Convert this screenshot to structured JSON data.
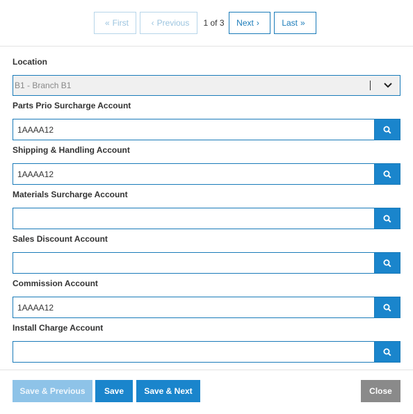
{
  "pager": {
    "first_label": "First",
    "previous_label": "Previous",
    "page_info": "1 of 3",
    "next_label": "Next",
    "last_label": "Last",
    "first_glyph": "«",
    "previous_glyph": "‹",
    "next_glyph": "›",
    "last_glyph": "»"
  },
  "form": {
    "location": {
      "label": "Location",
      "value": "B1 - Branch B1"
    },
    "parts_prio": {
      "label": "Parts Prio Surcharge Account",
      "value": "1AAAA12"
    },
    "shipping": {
      "label": "Shipping & Handling Account",
      "value": "1AAAA12"
    },
    "materials": {
      "label": "Materials Surcharge Account",
      "value": ""
    },
    "sales_discount": {
      "label": "Sales Discount Account",
      "value": ""
    },
    "commission": {
      "label": "Commission Account",
      "value": "1AAAA12"
    },
    "install_charge": {
      "label": "Install Charge Account",
      "value": ""
    }
  },
  "footer": {
    "save_previous_label": "Save & Previous",
    "save_label": "Save",
    "save_next_label": "Save & Next",
    "close_label": "Close"
  },
  "colors": {
    "accent": "#1a85cc",
    "border": "#1a7bb9",
    "disabled_button": "#8ec3e8",
    "close_button": "#8a8a8a"
  },
  "icons": {
    "lookup": "search-icon",
    "select": "chevron-down-icon"
  }
}
